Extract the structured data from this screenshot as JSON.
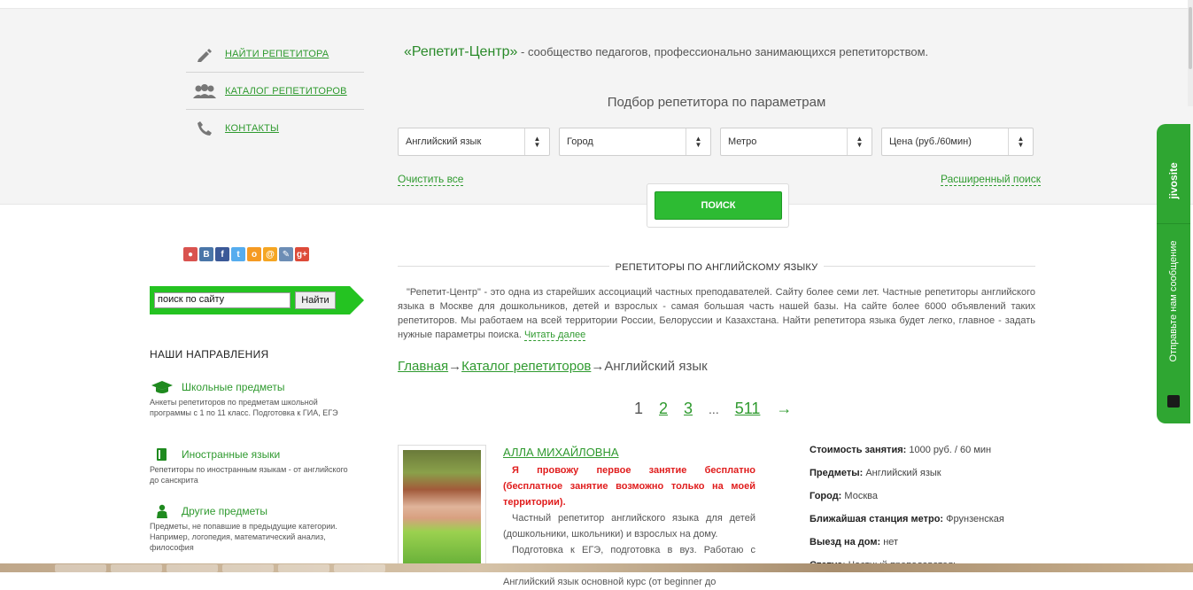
{
  "nav": [
    {
      "label": "НАЙТИ РЕПЕТИТОРА",
      "icon": "pen-icon"
    },
    {
      "label": "КАТАЛОГ РЕПЕТИТОРОВ",
      "icon": "people-icon"
    },
    {
      "label": "КОНТАКТЫ",
      "icon": "phone-icon"
    }
  ],
  "tagline": {
    "brand": "«Репетит-Центр»",
    "text": " - сообщество педагогов, профессионально занимающихся репетиторством."
  },
  "filter": {
    "title": "Подбор репетитора по параметрам",
    "selects": [
      "Английский язык",
      "Город",
      "Метро",
      "Цена (руб./60мин)"
    ],
    "clear_label": "Очистить все",
    "advanced_label": "Расширенный поиск",
    "search_label": "ПОИСК"
  },
  "social_icons": [
    "share-icon",
    "vk-icon",
    "facebook-icon",
    "twitter-icon",
    "odnoklassniki-icon",
    "mailru-icon",
    "livejournal-icon",
    "googleplus-icon"
  ],
  "social_glyphs": [
    "●",
    "B",
    "f",
    "t",
    "о",
    "@",
    "✎",
    "g+"
  ],
  "social_colors": [
    "#d9534f",
    "#4a76a8",
    "#3b5998",
    "#55acee",
    "#f59a23",
    "#f5a623",
    "#6c8db5",
    "#dd4b39"
  ],
  "site_search": {
    "value": "поиск по сайту",
    "button": "Найти"
  },
  "directions": {
    "title": "НАШИ НАПРАВЛЕНИЯ",
    "items": [
      {
        "label": "Школьные предметы",
        "desc": "Анкеты репетиторов по предметам школьной программы с 1 по 11 класс. Подготовка к ГИА, ЕГЭ"
      },
      {
        "label": "Иностранные языки",
        "desc": "Репетиторы по иностранным языкам - от английского до санскрита"
      },
      {
        "label": "Другие предметы",
        "desc": "Предметы, не попавшие в предыдущие категории. Например, логопедия, математический анализ, философия"
      }
    ]
  },
  "section": {
    "title": "РЕПЕТИТОРЫ ПО АНГЛИЙСКОМУ ЯЗЫКУ",
    "intro": "\"Репетит-Центр\" - это одна из старейших ассоциаций частных преподавателей. Сайту более семи лет. Частные репетиторы английского языка в Москве для дошкольников, детей и взрослых - самая большая часть нашей базы. На сайте более 6000 объявлений таких репетиторов. Мы работаем на всей территории России, Белоруссии и Казахстана. Найти репетитора языка будет легко, главное - задать нужные параметры поиска.",
    "read_more": "Читать далее"
  },
  "breadcrumbs": {
    "home": "Главная",
    "sep": "→",
    "catalog": "Каталог репетиторов",
    "current": "Английский язык"
  },
  "pager": {
    "current": "1",
    "pages": [
      "2",
      "3"
    ],
    "ellipsis": "...",
    "last": "511",
    "next": "→"
  },
  "tutor": {
    "name": "АЛЛА МИХАЙЛОВНА",
    "promo": "Я провожу первое занятие бесплатно (бесплатное занятие возможно только на моей территории).",
    "p1": "Частный репетитор английского языка для детей (дошкольники, школьники) и взрослых на дому.",
    "p2": "Подготовка к ЕГЭ, подготовка в вуз. Работаю с детьми, подростками, студентами и взрослыми. Английский язык основной курс (от beginner до",
    "details": [
      {
        "label": "Стоимость занятия:",
        "value": "1000 руб. / 60 мин"
      },
      {
        "label": "Предметы:",
        "value": "Английский язык"
      },
      {
        "label": "Город:",
        "value": "Москва"
      },
      {
        "label": "Ближайшая станция метро:",
        "value": "Фрунзенская"
      },
      {
        "label": "Выезд на дом:",
        "value": "нет"
      },
      {
        "label": "Статус:",
        "value": "Частный преподаватель"
      }
    ]
  },
  "jivo": {
    "brand": "jivosite",
    "text": "Отправьте нам сообщение"
  }
}
